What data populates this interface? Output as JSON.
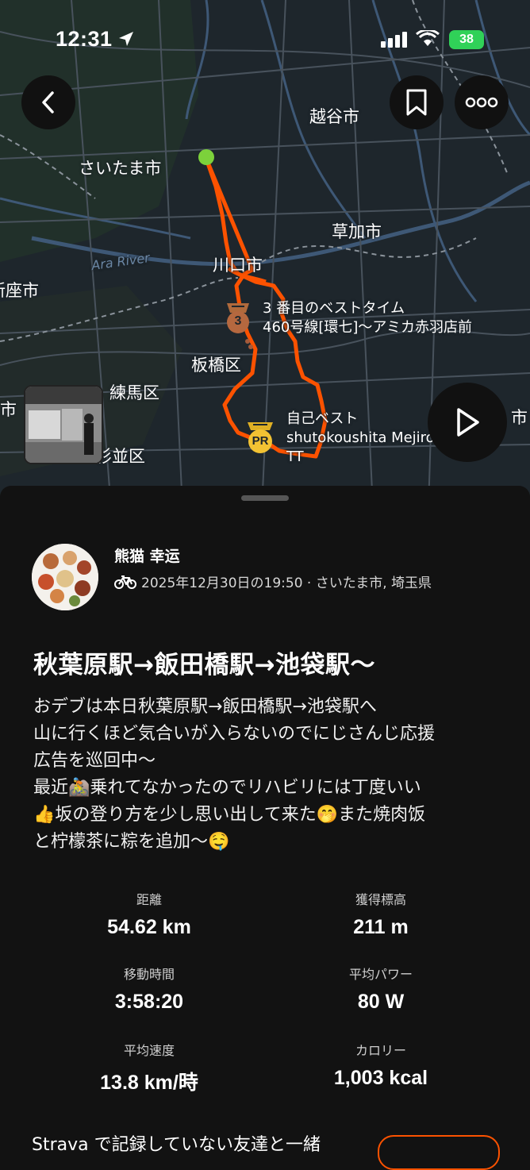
{
  "status_bar": {
    "time": "12:31",
    "battery": "38"
  },
  "map": {
    "labels": {
      "koshigaya": "越谷市",
      "saitama": "さいたま市",
      "soka": "草加市",
      "kawaguchi": "川口市",
      "niiza": "新座市",
      "ara_river": "Ara River",
      "itabashi": "板橋区",
      "nerima": "練馬区",
      "suginami": "杉並区",
      "edge_left": "市",
      "edge_right": "市"
    },
    "segments": {
      "best3_line1": "3 番目のベストタイム",
      "best3_line2": "460号線[環七]〜アミカ赤羽店前",
      "pr_line1": "自己ベスト",
      "pr_line2": "shutokoushita Mejiro",
      "pr_line3": "TT",
      "medal_number": "3",
      "pr_badge": "PR"
    },
    "colors": {
      "route": "#fc5200",
      "start": "#7cd13b"
    }
  },
  "activity": {
    "athlete_name": "熊猫 幸运",
    "meta": "2025年12月30日の19:50 · さいたま市, 埼玉県",
    "title": "秋葉原駅→飯田橋駅→池袋駅〜",
    "description": [
      "おデブは本日秋葉原駅→飯田橋駅→池袋駅へ",
      "山に行くほど気合いが入らないのでにじさんじ応援",
      "広告を巡回中〜",
      "最近🚵乗れてなかったのでリハビリには丁度いい",
      "👍坂の登り方を少し思い出して来た🤭また焼肉饭",
      "と柠檬茶に粽を追加〜🤤"
    ],
    "stats": [
      {
        "label": "距離",
        "value": "54.62 km"
      },
      {
        "label": "獲得標高",
        "value": "211 m"
      },
      {
        "label": "移動時間",
        "value": "3:58:20"
      },
      {
        "label": "平均パワー",
        "value": "80 W"
      },
      {
        "label": "平均速度",
        "value": "13.8 km/時"
      },
      {
        "label": "カロリー",
        "value": "1,003 kcal"
      }
    ],
    "promo_text": "Strava で記録していない友達と一緒"
  }
}
